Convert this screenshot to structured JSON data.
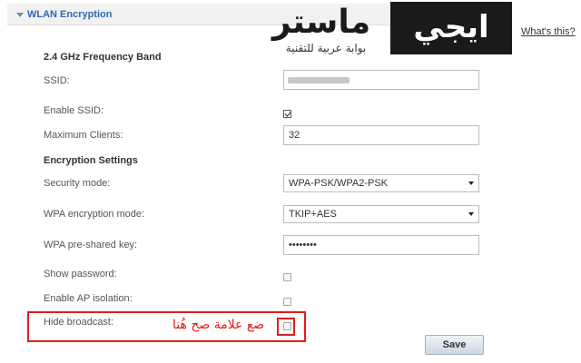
{
  "section": {
    "title": "WLAN Encryption"
  },
  "help_link": "What's this?",
  "watermark": {
    "box_text": "ايجي",
    "main_text": "ماستر",
    "sub_text": "بوابة عربية للتقنية"
  },
  "band_heading": "2.4 GHz Frequency Band",
  "encryption_heading": "Encryption Settings",
  "fields": {
    "ssid": {
      "label": "SSID:",
      "value": ""
    },
    "enable_ssid": {
      "label": "Enable SSID:",
      "checked": true
    },
    "max_clients": {
      "label": "Maximum Clients:",
      "value": "32"
    },
    "security_mode": {
      "label": "Security mode:",
      "value": "WPA-PSK/WPA2-PSK"
    },
    "wpa_encryption_mode": {
      "label": "WPA encryption mode:",
      "value": "TKIP+AES"
    },
    "psk": {
      "label": "WPA pre-shared key:",
      "value": "••••••••"
    },
    "show_password": {
      "label": "Show password:",
      "checked": false
    },
    "ap_isolation": {
      "label": "Enable AP isolation:",
      "checked": false
    },
    "hide_broadcast": {
      "label": "Hide broadcast:",
      "checked": false
    }
  },
  "annotation": "ضع علامة صح هُنا",
  "save_label": "Save",
  "colors": {
    "accent": "#2a6bb5",
    "highlight": "#e21c1c"
  }
}
